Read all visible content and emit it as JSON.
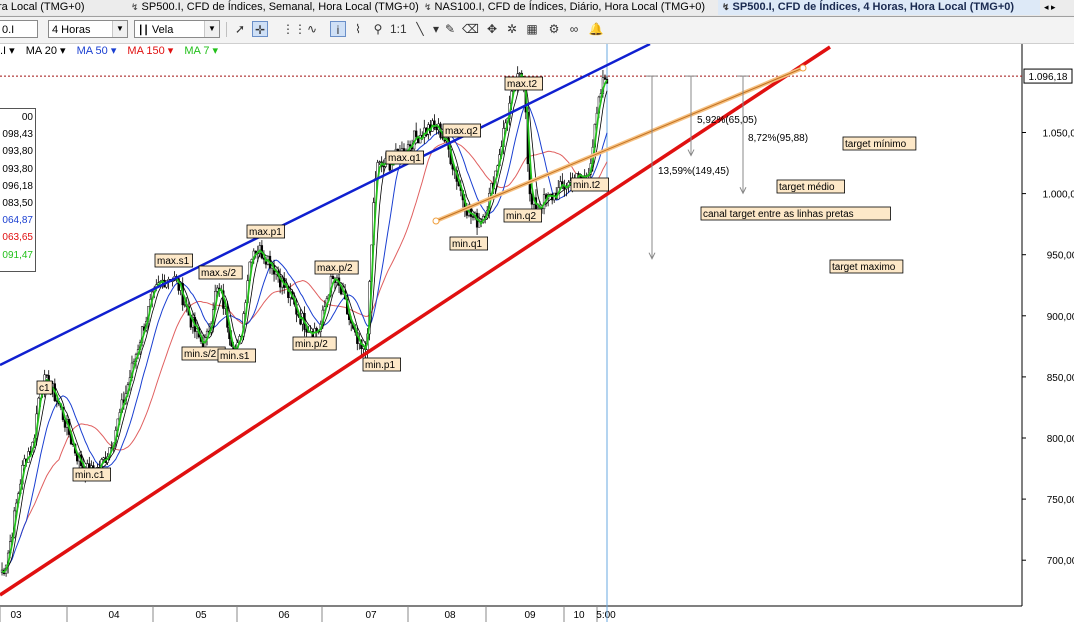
{
  "tabs": [
    {
      "label": "ra Local (TMG+0)",
      "active": false
    },
    {
      "label": "SP500.I, CFD de Índices, Semanal, Hora Local (TMG+0)",
      "active": false
    },
    {
      "label": "NAS100.I, CFD de Índices, Diário, Hora Local (TMG+0)",
      "active": false
    },
    {
      "label": "SP500.I, CFD de Índices, 4 Horas, Hora Local (TMG+0)",
      "active": true
    }
  ],
  "toolbar": {
    "symbol_value": "0.I",
    "timeframe_value": "4 Horas",
    "chart_type_value": "Vela",
    "icons": [
      "cursor-icon",
      "crosshair-icon",
      "grid-icon",
      "indicator-icon",
      "info-icon",
      "magnifier-icon",
      "zoom-ratio-icon",
      "line-icon",
      "arrow-down-icon",
      "pencil-icon",
      "eraser-icon",
      "move-icon",
      "magic-icon",
      "template-icon",
      "properties-icon",
      "link-icon",
      "alarm-icon"
    ]
  },
  "indicators": [
    {
      "label": ".I ▾",
      "color": "#000000"
    },
    {
      "label": "MA 20 ▾",
      "color": "#000000"
    },
    {
      "label": "MA 50 ▾",
      "color": "#1a3fd1"
    },
    {
      "label": "MA 150 ▾",
      "color": "#e01010"
    },
    {
      "label": "MA 7 ▾",
      "color": "#22c01a"
    }
  ],
  "data_panel": {
    "values": [
      {
        "text": "00",
        "color": "#000000"
      },
      {
        "text": "098,43",
        "color": "#000000"
      },
      {
        "text": "093,80",
        "color": "#000000"
      },
      {
        "text": "093,80",
        "color": "#000000"
      },
      {
        "text": "096,18",
        "color": "#000000"
      },
      {
        "text": "083,50",
        "color": "#000000"
      },
      {
        "text": "064,87",
        "color": "#1a3fd1"
      },
      {
        "text": "063,65",
        "color": "#e01010"
      },
      {
        "text": "091,47",
        "color": "#22c01a"
      }
    ]
  },
  "chart_data": {
    "type": "candlestick",
    "current_price_label": "1.096,18",
    "current_price": 1096.18,
    "y_ticks": [
      {
        "v": 1050,
        "label": "1.050,00"
      },
      {
        "v": 1000,
        "label": "1.000,00"
      },
      {
        "v": 950,
        "label": "950,00"
      },
      {
        "v": 900,
        "label": "900,00"
      },
      {
        "v": 850,
        "label": "850,00"
      },
      {
        "v": 800,
        "label": "800,00"
      },
      {
        "v": 750,
        "label": "750,00"
      },
      {
        "v": 700,
        "label": "700,00"
      }
    ],
    "x_ticks": [
      "03",
      "04",
      "05",
      "06",
      "07",
      "08",
      "09",
      "10",
      "5:00"
    ],
    "pivot_labels": [
      {
        "text": "max.t2",
        "v": 1105,
        "t": 0.862
      },
      {
        "text": "max.q2",
        "v": 1063,
        "t": 0.716
      },
      {
        "text": "max.q1",
        "v": 1033,
        "t": 0.622
      },
      {
        "text": "max.p1",
        "v": 966,
        "t": 0.418
      },
      {
        "text": "max.s1",
        "v": 939,
        "t": 0.28
      },
      {
        "text": "max.s/2",
        "v": 927,
        "t": 0.358
      },
      {
        "text": "max.p/2",
        "v": 930,
        "t": 0.548
      },
      {
        "text": "c1",
        "v": 846,
        "t": 0.07
      },
      {
        "text": "min.t2",
        "v": 1008,
        "t": 0.962
      },
      {
        "text": "min.q2",
        "v": 981,
        "t": 0.875
      },
      {
        "text": "min.q1",
        "v": 955,
        "t": 0.786
      },
      {
        "text": "min.s/2",
        "v": 871,
        "t": 0.337
      },
      {
        "text": "min.s1",
        "v": 869,
        "t": 0.39
      },
      {
        "text": "min.p/2",
        "v": 880,
        "t": 0.523
      },
      {
        "text": "min.p1",
        "v": 860,
        "t": 0.635
      },
      {
        "text": "min.c1",
        "v": 767,
        "t": 0.15
      }
    ],
    "target_labels": [
      {
        "text": "target mínimo",
        "v": 1042,
        "x_after": 1.38
      },
      {
        "text": "target médio",
        "v": 1006,
        "x_after": 1.29
      },
      {
        "text": "canal target entre as linhas pretas",
        "v": 984,
        "x_after": 1.2
      },
      {
        "text": "target maximo",
        "v": 940,
        "x_after": 1.36
      }
    ],
    "projections": [
      {
        "text": "5,92%(65,05)",
        "from": 1096.18,
        "to": 1031.13,
        "t_after": 1.13
      },
      {
        "text": "8,72%(95,88)",
        "from": 1096.18,
        "to": 1000.3,
        "t_after": 1.22
      },
      {
        "text": "13,59%(149,45)",
        "from": 1096.18,
        "to": 946.73,
        "t_after": 1.06
      }
    ],
    "trend_lines": [
      {
        "name": "upper-channel",
        "color": "#1020d0",
        "v_start": 860,
        "v_end": 1128,
        "t_start": 0,
        "t_end": 1.0
      },
      {
        "name": "lower-channel",
        "color": "#e01010",
        "v_start": 680,
        "v_end": 1105,
        "t_start": 0,
        "t_end": 1.3
      },
      {
        "name": "short-trend",
        "color": "#f0b060",
        "v_start": 976,
        "v_end": 1105,
        "t_start": 0.77,
        "t_end": 1.33
      }
    ]
  }
}
